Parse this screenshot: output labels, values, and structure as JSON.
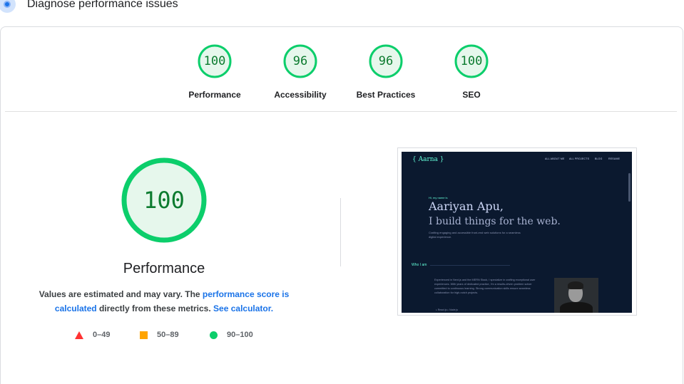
{
  "header": {
    "title": "Diagnose performance issues",
    "icon": "lighthouse-icon"
  },
  "colors": {
    "pass": "#0cce6b",
    "pass_text": "#0c7b2f",
    "pass_fill": "#e6f7ec",
    "average": "#ffa400",
    "fail": "#ff3333",
    "link": "#1a73e8"
  },
  "categories": [
    {
      "label": "Performance",
      "score": "100",
      "value": 100
    },
    {
      "label": "Accessibility",
      "score": "96",
      "value": 96
    },
    {
      "label": "Best Practices",
      "score": "96",
      "value": 96
    },
    {
      "label": "SEO",
      "score": "100",
      "value": 100
    }
  ],
  "performance": {
    "score": "100",
    "value": 100,
    "title": "Performance",
    "desc_prefix": "Values are estimated and may vary. The ",
    "link_score": "performance score is calculated",
    "desc_middle": " directly from these metrics. ",
    "link_calculator": "See calculator."
  },
  "legend": [
    {
      "range": "0–49",
      "shape": "triangle"
    },
    {
      "range": "50–89",
      "shape": "square"
    },
    {
      "range": "90–100",
      "shape": "circle"
    }
  ],
  "screenshot": {
    "logo": "{ Aarna }",
    "nav": [
      "ALL ABOUT ME",
      "ALL PROJECTS",
      "BLOG",
      "RESUME"
    ],
    "hi": "Hi, my name is",
    "name": "Aariyan Apu,",
    "tagline": "I build things for the web.",
    "sub": "Crafting engaging and accessible front-end web solutions for a seamless digital experience.",
    "who": "Who I am",
    "bio": "Experienced in Next.js and the MERN Stack, I specialize in crafting exceptional user experiences. With years of dedicated practice, I'm a results-driven problem solver committed to continuous learning. Strong communication skills ensure seamless collaboration for high-notch projects.",
    "footer": "▹ React.js          ▹ Node.js"
  }
}
